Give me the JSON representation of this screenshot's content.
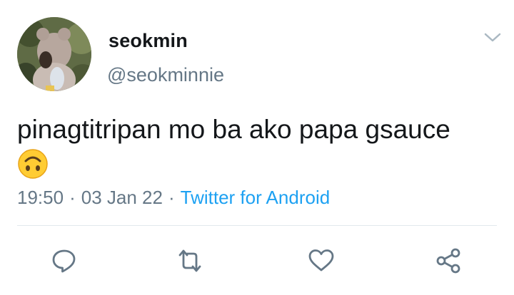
{
  "tweet": {
    "display_name": "seokmin",
    "handle": "@seokminnie",
    "text": "pinagtitripan mo ba ako papa gsauce",
    "emoji": "upside-down-face-emoji",
    "time": "19:50",
    "date": "03 Jan 22",
    "separator": "·",
    "source": "Twitter for Android"
  },
  "actions": [
    {
      "name": "reply",
      "icon": "reply-icon"
    },
    {
      "name": "retweet",
      "icon": "retweet-icon"
    },
    {
      "name": "like",
      "icon": "heart-icon"
    },
    {
      "name": "share",
      "icon": "share-icon"
    }
  ],
  "colors": {
    "text": "#14171a",
    "secondary": "#657786",
    "link": "#1da1f2",
    "divider": "#e1e8ed",
    "icon": "#657786"
  }
}
